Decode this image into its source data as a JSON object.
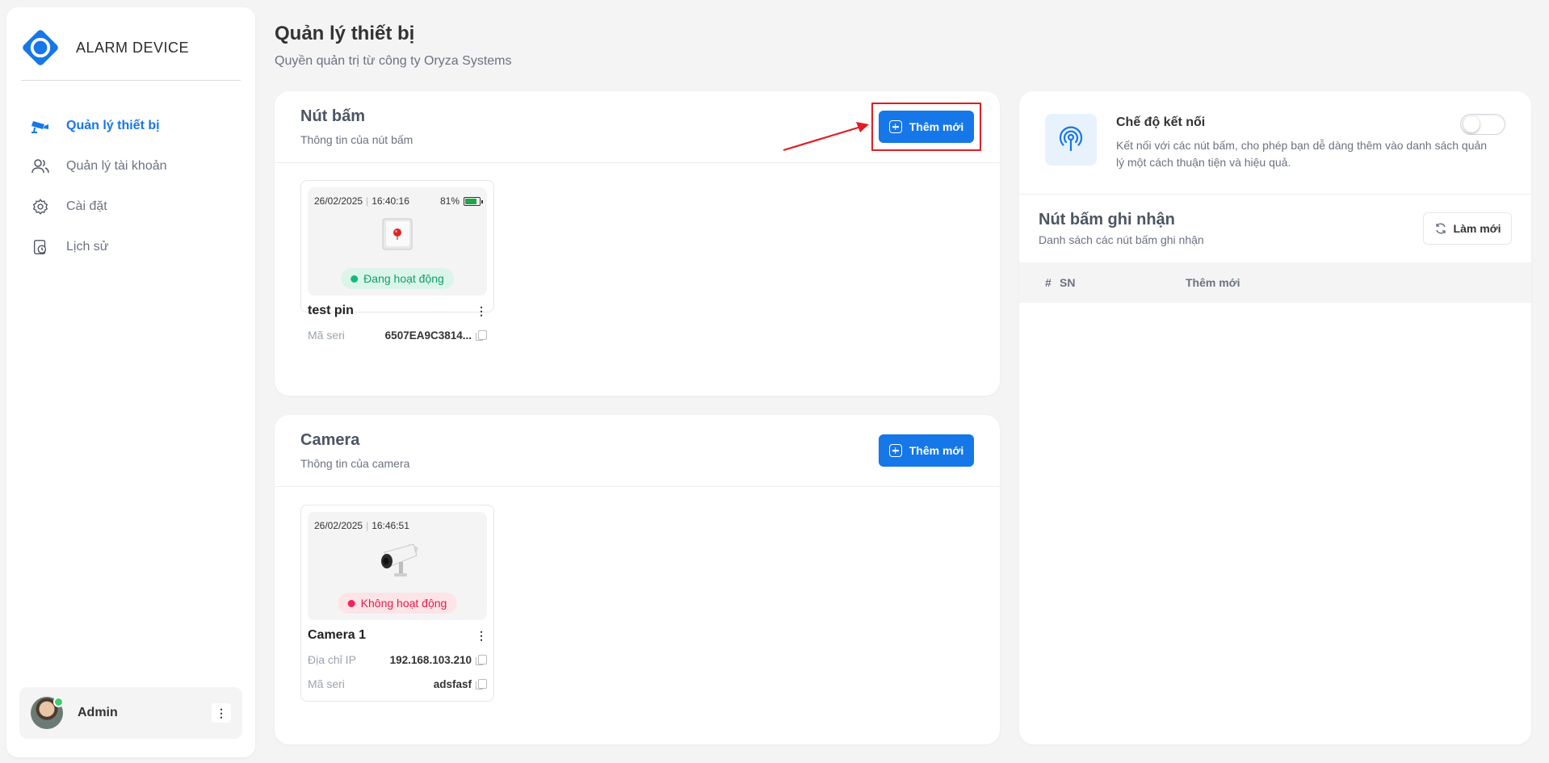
{
  "brand": {
    "name": "ALARM DEVICE",
    "accent": "#1677e8"
  },
  "sidebar": {
    "items": [
      {
        "label": "Quản lý thiết bị",
        "icon": "cctv-icon",
        "active": true
      },
      {
        "label": "Quản lý tài khoản",
        "icon": "users-icon",
        "active": false
      },
      {
        "label": "Cài đặt",
        "icon": "gear-icon",
        "active": false
      },
      {
        "label": "Lịch sử",
        "icon": "history-icon",
        "active": false
      }
    ],
    "user": {
      "name": "Admin"
    }
  },
  "header": {
    "title": "Quản lý thiết bị",
    "subtitle": "Quyền quản trị từ công ty Oryza Systems"
  },
  "buttons_panel": {
    "title": "Nút bấm",
    "subtitle": "Thông tin của nút bấm",
    "add_label": "Thêm mới",
    "devices": [
      {
        "date": "26/02/2025",
        "time": "16:40:16",
        "battery": "81%",
        "battery_level": 0.81,
        "status": "Đang hoạt động",
        "name": "test pin",
        "serial_label": "Mã seri",
        "serial": "6507EA9C3814..."
      }
    ]
  },
  "camera_panel": {
    "title": "Camera",
    "subtitle": "Thông tin của camera",
    "add_label": "Thêm mới",
    "devices": [
      {
        "date": "26/02/2025",
        "time": "16:46:51",
        "status": "Không hoạt động",
        "name": "Camera 1",
        "ip_label": "Địa chỉ IP",
        "ip": "192.168.103.210",
        "serial_label": "Mã seri",
        "serial": "adsfasf"
      }
    ]
  },
  "connect_mode": {
    "title": "Chế độ kết nối",
    "description": "Kết nối với các nút bấm, cho phép bạn dễ dàng thêm vào danh sách quản lý một cách thuận tiện và hiệu quả.",
    "enabled": false
  },
  "received": {
    "title": "Nút bấm ghi nhận",
    "subtitle": "Danh sách các nút bấm ghi nhận",
    "refresh_label": "Làm mới",
    "columns": [
      "#",
      "SN",
      "Thêm mới"
    ]
  }
}
